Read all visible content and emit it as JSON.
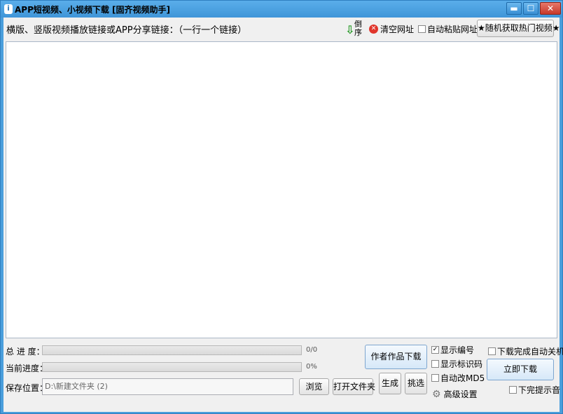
{
  "window": {
    "title": "APP短视频、小视频下载 [固齐视频助手]",
    "icon": "app-info-icon",
    "controls": {
      "minimize": "▬",
      "maximize": "☐",
      "close": "✕"
    }
  },
  "top": {
    "instruction": "横版、竖版视频播放链接或APP分享链接：（一行一个链接）",
    "sort_label": "倒序",
    "sort_arrow": "⇩",
    "clear_label": "清空网址",
    "clear_icon_glyph": "✕",
    "auto_paste_label": "自动粘贴网址",
    "auto_paste_checked": false,
    "random_hot_label": "★随机获取热门视频★"
  },
  "url_textarea": {
    "value": ""
  },
  "progress": {
    "total_label": "总 进 度：",
    "total_value": "0/0",
    "total_fraction": 0,
    "current_label": "当前进度：",
    "current_value": "0%",
    "current_fraction": 0
  },
  "save": {
    "label": "保存位置：",
    "path": "D:\\新建文件夹 (2)",
    "browse_label": "浏览",
    "open_folder_label": "打开文件夹"
  },
  "actions": {
    "author_download_label": "作者作品下载",
    "generate_label": "生成",
    "select_label": "挑选",
    "download_now_label": "立即下载"
  },
  "options": {
    "show_number_label": "显示编号",
    "show_number_checked": true,
    "show_marker_label": "显示标识码",
    "show_marker_checked": false,
    "auto_md5_label": "自动改MD5",
    "auto_md5_checked": false,
    "advanced_label": "高级设置",
    "shutdown_label": "下载完成自动关机",
    "shutdown_checked": false,
    "sound_label": "下完提示音",
    "sound_checked": false
  },
  "colors": {
    "title_bar": "#4a9edc",
    "progress_fill": "#4fb24f",
    "close_button": "#c7392b"
  }
}
